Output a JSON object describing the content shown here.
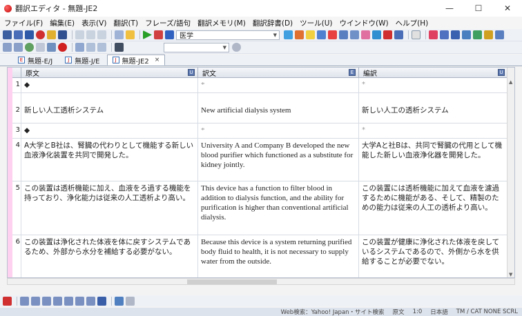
{
  "window": {
    "title": "翻訳エディタ - 無題-JE2",
    "minimize": "—",
    "maximize": "☐",
    "close": "✕"
  },
  "menu": [
    "ファイル(F)",
    "編集(E)",
    "表示(V)",
    "翻訳(T)",
    "フレーズ/語句",
    "翻訳メモリ(M)",
    "翻訳辞書(D)",
    "ツール(U)",
    "ウインドウ(W)",
    "ヘルプ(H)"
  ],
  "toolbar": {
    "dictionary_select": "医学"
  },
  "tabs": [
    {
      "label": "無題-E/J",
      "active": false
    },
    {
      "label": "無題-J/E",
      "active": false
    },
    {
      "label": "無題-JE2",
      "active": true,
      "close": "×"
    }
  ],
  "grid": {
    "headers": {
      "source": "原文",
      "translation": "訳文",
      "edited": "編訳"
    },
    "rows": [
      {
        "num": "1",
        "source": "◆",
        "translation": "*",
        "edited": "*"
      },
      {
        "num": "2",
        "source": "新しい人工透析システム",
        "translation": "New artificial dialysis system",
        "edited": "新しい人工の透析システム"
      },
      {
        "num": "3",
        "source": "◆",
        "translation": "*",
        "edited": "*"
      },
      {
        "num": "4",
        "source": "A大学とB社は、腎臓の代わりとして機能する新しい血液浄化装置を共同で開発した。",
        "translation": "University A and Company B developed the new blood purifier which functioned as a substitute for kidney jointly.",
        "edited": "大学Aと社Bは、共同で腎臓の代用として機能した新しい血液浄化器を開発した。"
      },
      {
        "num": "5",
        "source": "この装置は透析機能に加え、血液をろ過する機能を持っており、浄化能力は従来の人工透析より高い。",
        "translation": "This device has a function to filter blood in addition to dialysis function, and the ability for purification is higher than conventional artificial dialysis.",
        "edited": "この装置には透析機能に加えて血液を濾過するために機能がある、そして、精製のための能力は従来の人工の透析より高い。"
      },
      {
        "num": "6",
        "source": "この装置は浄化された体液を体に戻すシステムであるため、外部から水分を補給する必要がない。",
        "translation": "Because this device is a system returning purified body fluid to health, it is not necessary to supply water from the outside.",
        "edited": "この装置が健康に浄化された体液を戻しているシステムであるので、外側から水を供給することが必要でない。"
      }
    ]
  },
  "status": {
    "web_search": "Web検索：Yahoo! Japan・サイト検索",
    "mode": "原文",
    "position": "1:0",
    "language": "日本語",
    "extra": "TM / CAT NONE SCRL"
  },
  "colors": {
    "pinkbar": "#ffd1f0",
    "header_button": "#5c78b0"
  }
}
